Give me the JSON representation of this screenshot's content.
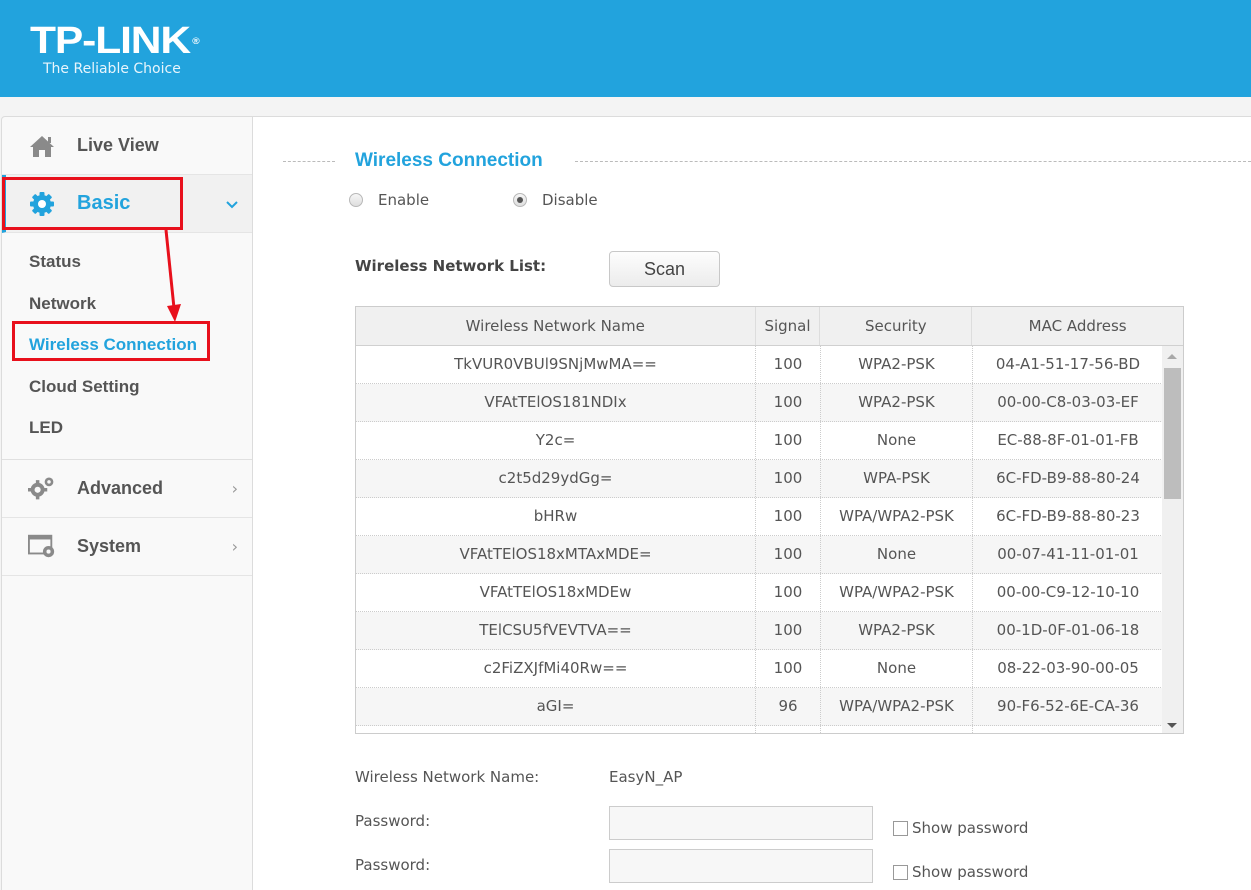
{
  "header": {
    "brand": "TP-LINK",
    "registered": "®",
    "tagline": "The Reliable Choice",
    "bg_color": "#22a3dd"
  },
  "sidebar": {
    "live_view": {
      "label": "Live View",
      "icon": "home-icon"
    },
    "basic": {
      "label": "Basic",
      "icon": "gear-icon",
      "expanded": true,
      "chevron": "⌄"
    },
    "basic_items": [
      {
        "label": "Status",
        "active": false
      },
      {
        "label": "Network",
        "active": false
      },
      {
        "label": "Wireless Connection",
        "active": true
      },
      {
        "label": "Cloud Setting",
        "active": false
      },
      {
        "label": "LED",
        "active": false
      }
    ],
    "advanced": {
      "label": "Advanced",
      "icon": "gears-icon",
      "chevron": "›"
    },
    "system": {
      "label": "System",
      "icon": "system-window-icon",
      "chevron": "›"
    }
  },
  "main": {
    "section_title": "Wireless Connection",
    "radio": {
      "enable_label": "Enable",
      "disable_label": "Disable",
      "selected": "Disable"
    },
    "list_label": "Wireless Network List:",
    "scan_label": "Scan",
    "table": {
      "columns": [
        "Wireless Network Name",
        "Signal",
        "Security",
        "MAC Address"
      ],
      "rows": [
        [
          "TkVUR0VBUl9SNjMwMA==",
          "100",
          "WPA2-PSK",
          "04-A1-51-17-56-BD"
        ],
        [
          "VFAtTElOS181NDIx",
          "100",
          "WPA2-PSK",
          "00-00-C8-03-03-EF"
        ],
        [
          "Y2c=",
          "100",
          "None",
          "EC-88-8F-01-01-FB"
        ],
        [
          "c2t5d29ydGg=",
          "100",
          "WPA-PSK",
          "6C-FD-B9-88-80-24"
        ],
        [
          "bHRw",
          "100",
          "WPA/WPA2-PSK",
          "6C-FD-B9-88-80-23"
        ],
        [
          "VFAtTElOS18xMTAxMDE=",
          "100",
          "None",
          "00-07-41-11-01-01"
        ],
        [
          "VFAtTElOS18xMDEw",
          "100",
          "WPA/WPA2-PSK",
          "00-00-C9-12-10-10"
        ],
        [
          "TElCSU5fVEVTVA==",
          "100",
          "WPA2-PSK",
          "00-1D-0F-01-06-18"
        ],
        [
          "c2FiZXJfMi40Rw==",
          "100",
          "None",
          "08-22-03-90-00-05"
        ],
        [
          "aGI=",
          "96",
          "WPA/WPA2-PSK",
          "90-F6-52-6E-CA-36"
        ],
        [
          "",
          "",
          "",
          ""
        ]
      ]
    },
    "form": {
      "ssid_label": "Wireless Network Name:",
      "ssid_value": "EasyN_AP",
      "password_label": "Password:",
      "password_value": "",
      "password2_label": "Password:",
      "password2_value": "",
      "show_password_label": "Show password"
    }
  },
  "annotation": {
    "highlight_color": "#e8101c"
  }
}
